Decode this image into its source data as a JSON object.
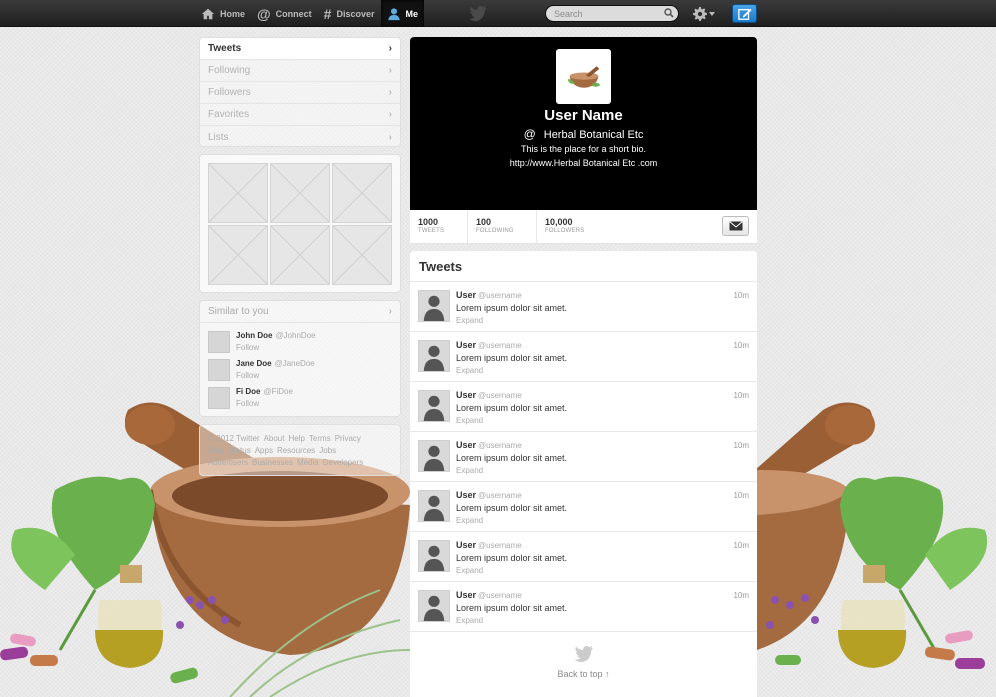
{
  "topbar": {
    "nav": [
      {
        "label": "Home",
        "icon": "home-icon",
        "active": false
      },
      {
        "label": "Connect",
        "icon": "at-icon",
        "active": false
      },
      {
        "label": "Discover",
        "icon": "hash-icon",
        "active": false
      },
      {
        "label": "Me",
        "icon": "person-icon",
        "active": true
      }
    ],
    "search_placeholder": "Search"
  },
  "sidebar": {
    "menu": [
      {
        "label": "Tweets",
        "active": true
      },
      {
        "label": "Following",
        "active": false
      },
      {
        "label": "Followers",
        "active": false
      },
      {
        "label": "Favorites",
        "active": false
      },
      {
        "label": "Lists",
        "active": false
      }
    ],
    "similar_title": "Similar to you",
    "similar": [
      {
        "name": "John Doe",
        "handle": "@JohnDoe",
        "follow": "Follow"
      },
      {
        "name": "Jane Doe",
        "handle": "@JaneDoe",
        "follow": "Follow"
      },
      {
        "name": "Fi Doe",
        "handle": "@FiDoe",
        "follow": "Follow"
      }
    ],
    "footer": [
      "© 2012 Twitter",
      "About",
      "Help",
      "Terms",
      "Privacy",
      "Blog",
      "Status",
      "Apps",
      "Resources",
      "Jobs",
      "Advertisers",
      "Businesses",
      "Media",
      "Developers"
    ]
  },
  "profile": {
    "name": "User Name",
    "at": "@",
    "handle": "Herbal Botanical Etc",
    "bio": "This is the place for a short bio.",
    "url": "http://www.Herbal Botanical Etc .com",
    "stats": [
      {
        "num": "1000",
        "label": "TWEETS"
      },
      {
        "num": "100",
        "label": "FOLLOWING"
      },
      {
        "num": "10,000",
        "label": "FOLLOWERS"
      }
    ]
  },
  "stream": {
    "title": "Tweets",
    "tweets": [
      {
        "user": "User",
        "handle": "@username",
        "text": "Lorem ipsum dolor sit amet.",
        "expand": "Expand",
        "time": "10m"
      },
      {
        "user": "User",
        "handle": "@username",
        "text": "Lorem ipsum dolor sit amet.",
        "expand": "Expand",
        "time": "10m"
      },
      {
        "user": "User",
        "handle": "@username",
        "text": "Lorem ipsum dolor sit amet.",
        "expand": "Expand",
        "time": "10m"
      },
      {
        "user": "User",
        "handle": "@username",
        "text": "Lorem ipsum dolor sit amet.",
        "expand": "Expand",
        "time": "10m"
      },
      {
        "user": "User",
        "handle": "@username",
        "text": "Lorem ipsum dolor sit amet.",
        "expand": "Expand",
        "time": "10m"
      },
      {
        "user": "User",
        "handle": "@username",
        "text": "Lorem ipsum dolor sit amet.",
        "expand": "Expand",
        "time": "10m"
      },
      {
        "user": "User",
        "handle": "@username",
        "text": "Lorem ipsum dolor sit amet.",
        "expand": "Expand",
        "time": "10m"
      }
    ],
    "back_to_top": "Back to top ↑"
  },
  "colors": {
    "topbar": "#2b2b2b",
    "accent": "#1b7ac8",
    "header_bg": "#000000",
    "bowl": "#a0643a",
    "leaf": "#6ab04c"
  }
}
